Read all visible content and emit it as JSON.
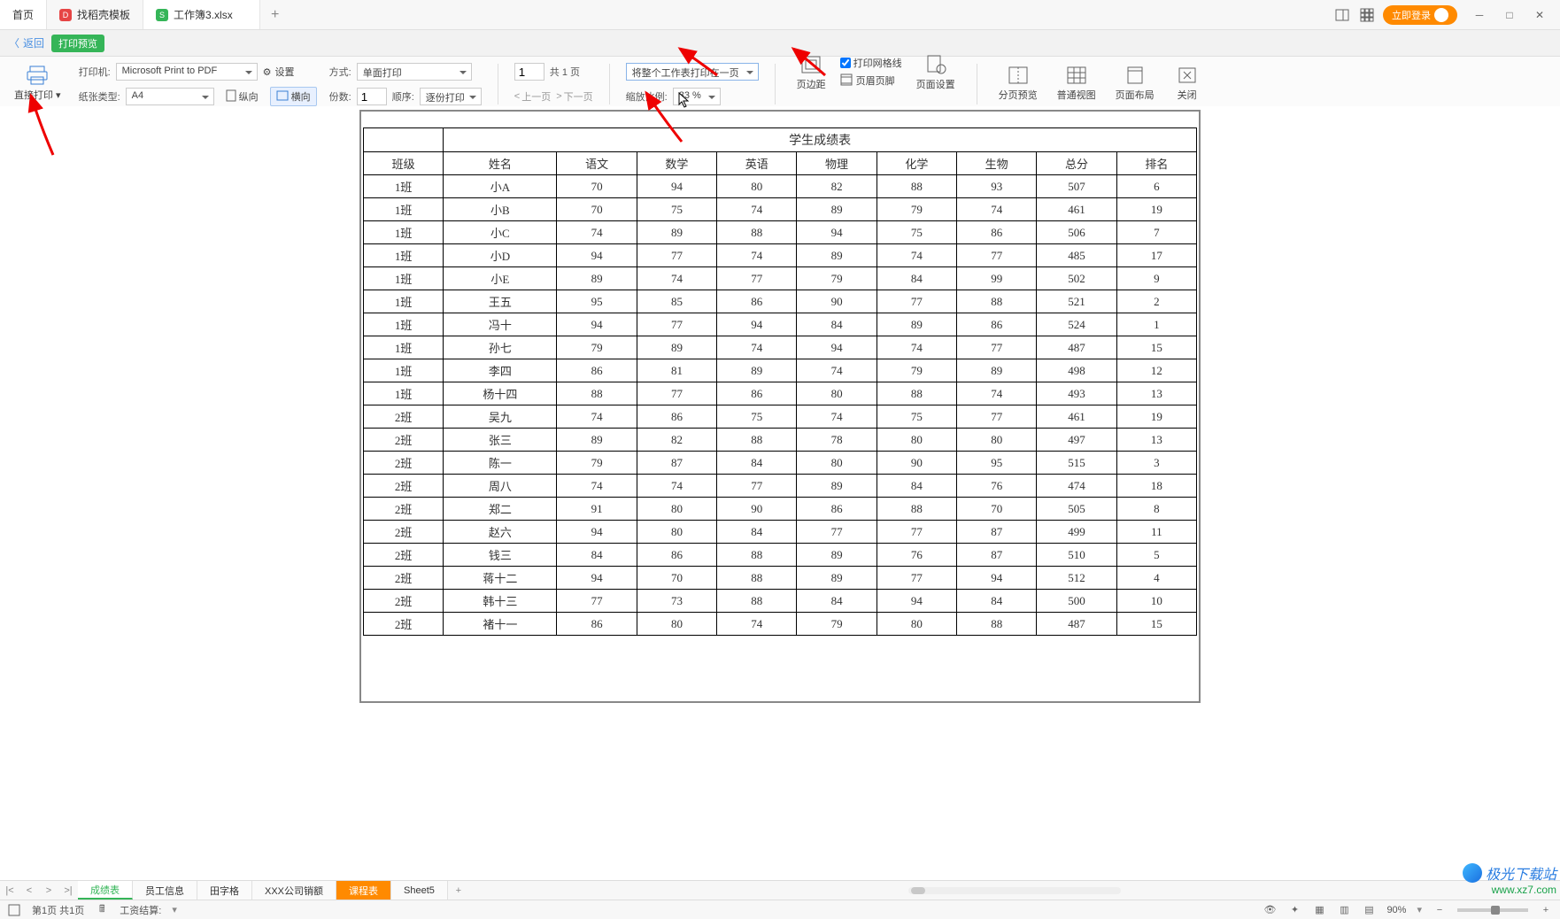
{
  "titlebar": {
    "tabs": {
      "home": "首页",
      "template": "找稻壳模板",
      "doc": "工作簿3.xlsx"
    },
    "login": "立即登录"
  },
  "crumb": {
    "back": "返回",
    "title": "打印预览"
  },
  "toolbar": {
    "direct_print": "直接打印",
    "printer_label": "打印机:",
    "printer_value": "Microsoft Print to PDF",
    "paper_label": "纸张类型:",
    "paper_value": "A4",
    "settings": "设置",
    "portrait": "纵向",
    "landscape": "横向",
    "mode_label": "方式:",
    "mode_value": "单面打印",
    "copies_label": "份数:",
    "copies_value": "1",
    "order_label": "顺序:",
    "order_value": "逐份打印",
    "page_input": "1",
    "page_total": "共 1 页",
    "prev_page": "上一页",
    "next_page": "下一页",
    "fit_select": "将整个工作表打印在一页",
    "zoom_label": "缩放比例:",
    "zoom_value": "83 %",
    "print_gridlines": "打印网格线",
    "margins": "页边距",
    "header_footer": "页眉页脚",
    "page_setup": "页面设置",
    "page_break_preview": "分页预览",
    "normal_view": "普通视图",
    "page_layout": "页面布局",
    "close": "关闭"
  },
  "chart_data": {
    "type": "table",
    "title": "学生成绩表",
    "columns": [
      "班级",
      "姓名",
      "语文",
      "数学",
      "英语",
      "物理",
      "化学",
      "生物",
      "总分",
      "排名"
    ],
    "rows": [
      [
        "1班",
        "小A",
        "70",
        "94",
        "80",
        "82",
        "88",
        "93",
        "507",
        "6"
      ],
      [
        "1班",
        "小B",
        "70",
        "75",
        "74",
        "89",
        "79",
        "74",
        "461",
        "19"
      ],
      [
        "1班",
        "小C",
        "74",
        "89",
        "88",
        "94",
        "75",
        "86",
        "506",
        "7"
      ],
      [
        "1班",
        "小D",
        "94",
        "77",
        "74",
        "89",
        "74",
        "77",
        "485",
        "17"
      ],
      [
        "1班",
        "小E",
        "89",
        "74",
        "77",
        "79",
        "84",
        "99",
        "502",
        "9"
      ],
      [
        "1班",
        "王五",
        "95",
        "85",
        "86",
        "90",
        "77",
        "88",
        "521",
        "2"
      ],
      [
        "1班",
        "冯十",
        "94",
        "77",
        "94",
        "84",
        "89",
        "86",
        "524",
        "1"
      ],
      [
        "1班",
        "孙七",
        "79",
        "89",
        "74",
        "94",
        "74",
        "77",
        "487",
        "15"
      ],
      [
        "1班",
        "李四",
        "86",
        "81",
        "89",
        "74",
        "79",
        "89",
        "498",
        "12"
      ],
      [
        "1班",
        "杨十四",
        "88",
        "77",
        "86",
        "80",
        "88",
        "74",
        "493",
        "13"
      ],
      [
        "2班",
        "吴九",
        "74",
        "86",
        "75",
        "74",
        "75",
        "77",
        "461",
        "19"
      ],
      [
        "2班",
        "张三",
        "89",
        "82",
        "88",
        "78",
        "80",
        "80",
        "497",
        "13"
      ],
      [
        "2班",
        "陈一",
        "79",
        "87",
        "84",
        "80",
        "90",
        "95",
        "515",
        "3"
      ],
      [
        "2班",
        "周八",
        "74",
        "74",
        "77",
        "89",
        "84",
        "76",
        "474",
        "18"
      ],
      [
        "2班",
        "郑二",
        "91",
        "80",
        "90",
        "86",
        "88",
        "70",
        "505",
        "8"
      ],
      [
        "2班",
        "赵六",
        "94",
        "80",
        "84",
        "77",
        "77",
        "87",
        "499",
        "11"
      ],
      [
        "2班",
        "钱三",
        "84",
        "86",
        "88",
        "89",
        "76",
        "87",
        "510",
        "5"
      ],
      [
        "2班",
        "蒋十二",
        "94",
        "70",
        "88",
        "89",
        "77",
        "94",
        "512",
        "4"
      ],
      [
        "2班",
        "韩十三",
        "77",
        "73",
        "88",
        "84",
        "94",
        "84",
        "500",
        "10"
      ],
      [
        "2班",
        "褚十一",
        "86",
        "80",
        "74",
        "79",
        "80",
        "88",
        "487",
        "15"
      ]
    ]
  },
  "sheet_tabs": [
    "成绩表",
    "员工信息",
    "田字格",
    "XXX公司销额",
    "课程表",
    "Sheet5"
  ],
  "status": {
    "page_info": "第1页 共1页",
    "calc_result": "工资结算:",
    "zoom": "90%"
  },
  "watermark": {
    "name": "极光下载站",
    "url": "www.xz7.com"
  }
}
